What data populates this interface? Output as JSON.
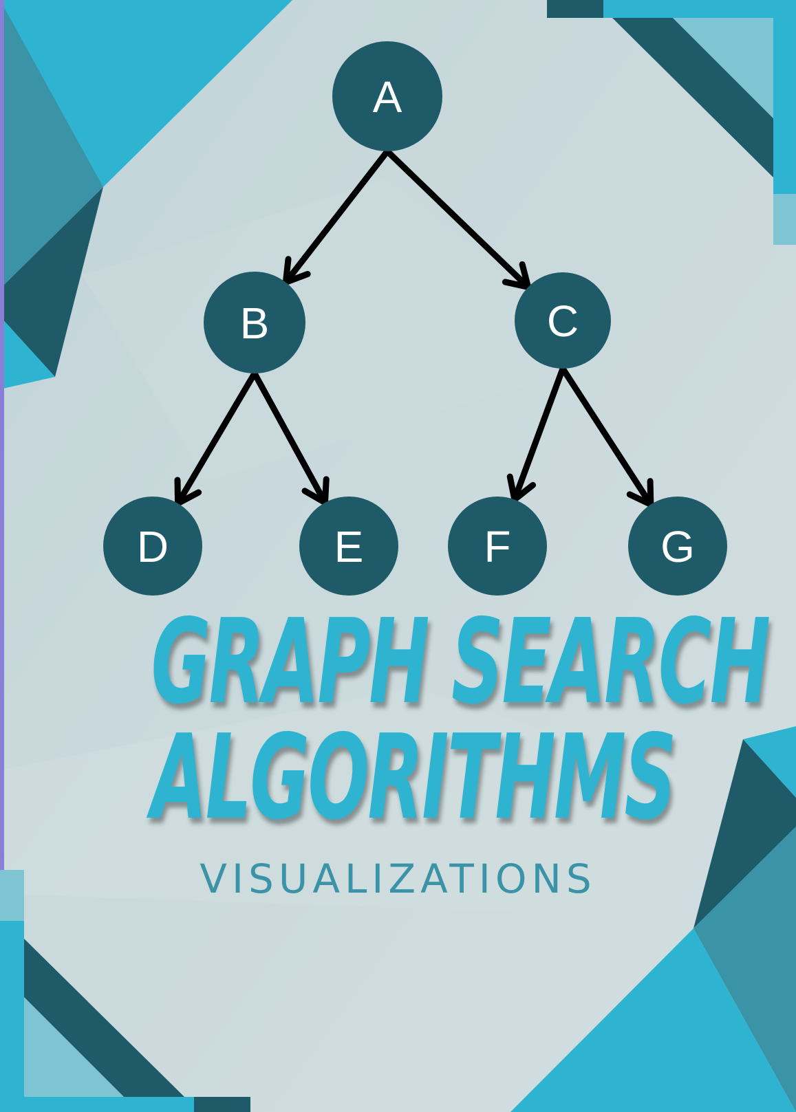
{
  "title_line_1": "GRAPH SEARCH",
  "title_line_2": "ALGORITHMS",
  "subtitle": "VISUALIZATIONS",
  "graph": {
    "nodes": [
      {
        "id": "A",
        "label": "A"
      },
      {
        "id": "B",
        "label": "B"
      },
      {
        "id": "C",
        "label": "C"
      },
      {
        "id": "D",
        "label": "D"
      },
      {
        "id": "E",
        "label": "E"
      },
      {
        "id": "F",
        "label": "F"
      },
      {
        "id": "G",
        "label": "G"
      }
    ],
    "edges": [
      {
        "from": "A",
        "to": "B"
      },
      {
        "from": "A",
        "to": "C"
      },
      {
        "from": "B",
        "to": "D"
      },
      {
        "from": "B",
        "to": "E"
      },
      {
        "from": "C",
        "to": "F"
      },
      {
        "from": "C",
        "to": "G"
      }
    ]
  },
  "colors": {
    "background": "#c9d8da",
    "node_fill": "#1f5a68",
    "edge": "#000000",
    "title": "#2eb4d1",
    "subtitle": "#3b93a8",
    "accent_light": "#2eb4d1",
    "accent_mid": "#3b93a8",
    "accent_dark": "#1f5a68",
    "accent_pale": "#7ec4d3"
  }
}
